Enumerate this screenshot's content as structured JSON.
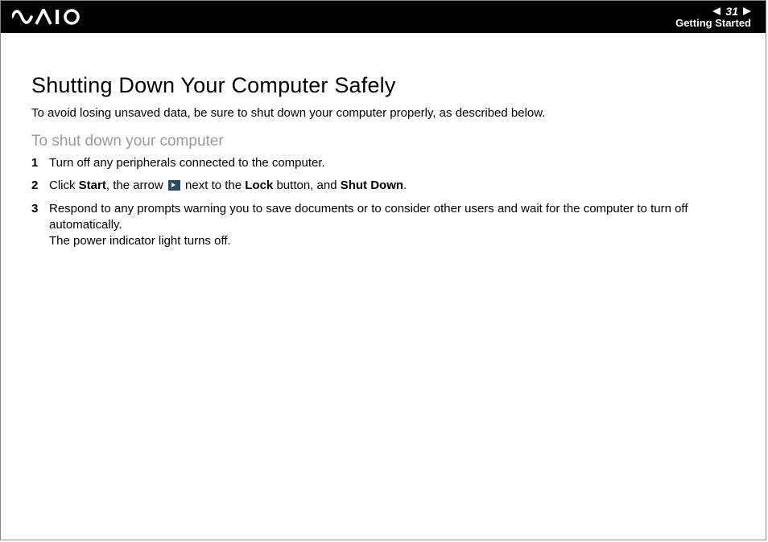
{
  "header": {
    "page_number": "31",
    "section": "Getting Started"
  },
  "content": {
    "title": "Shutting Down Your Computer Safely",
    "intro": "To avoid losing unsaved data, be sure to shut down your computer properly, as described below.",
    "subhead": "To shut down your computer",
    "steps": {
      "s1": {
        "num": "1",
        "text": "Turn off any peripherals connected to the computer."
      },
      "s2": {
        "num": "2",
        "t1": "Click ",
        "b1": "Start",
        "t2": ", the arrow ",
        "t3": " next to the ",
        "b2": "Lock",
        "t4": " button, and ",
        "b3": "Shut Down",
        "t5": "."
      },
      "s3": {
        "num": "3",
        "line1": "Respond to any prompts warning you to save documents or to consider other users and wait for the computer to turn off automatically.",
        "line2": "The power indicator light turns off."
      }
    }
  }
}
